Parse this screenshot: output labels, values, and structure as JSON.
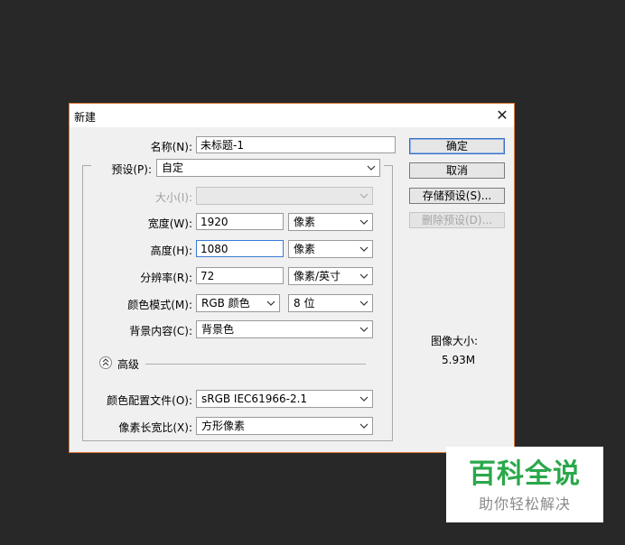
{
  "dialog": {
    "title": "新建",
    "close_glyph": "✕"
  },
  "form": {
    "name_label": "名称(N):",
    "name_value": "未标题-1",
    "preset_label": "预设(P):",
    "preset_value": "自定",
    "size_label": "大小(I):",
    "size_value": "",
    "width_label": "宽度(W):",
    "width_value": "1920",
    "width_unit": "像素",
    "height_label": "高度(H):",
    "height_value": "1080",
    "height_unit": "像素",
    "resolution_label": "分辨率(R):",
    "resolution_value": "72",
    "resolution_unit": "像素/英寸",
    "color_mode_label": "颜色模式(M):",
    "color_mode_value": "RGB 颜色",
    "bit_depth_value": "8 位",
    "background_label": "背景内容(C):",
    "background_value": "背景色",
    "advanced_label": "高级",
    "color_profile_label": "颜色配置文件(O):",
    "color_profile_value": "sRGB IEC61966-2.1",
    "pixel_aspect_label": "像素长宽比(X):",
    "pixel_aspect_value": "方形像素"
  },
  "buttons": {
    "ok": "确定",
    "cancel": "取消",
    "save_preset": "存储预设(S)...",
    "delete_preset": "删除预设(D)..."
  },
  "image_size": {
    "label": "图像大小:",
    "value": "5.93M"
  },
  "watermark": {
    "title": "百科全说",
    "subtitle": "助你轻松解决"
  },
  "icons": {
    "dropdown": "chevron-down-icon",
    "advanced_toggle": "chevron-up-icon",
    "close": "close-icon"
  },
  "colors": {
    "dialog_border": "#e07b39",
    "default_button_border": "#3a6fc4",
    "watermark_green": "#2aa84a",
    "background": "#282828"
  }
}
